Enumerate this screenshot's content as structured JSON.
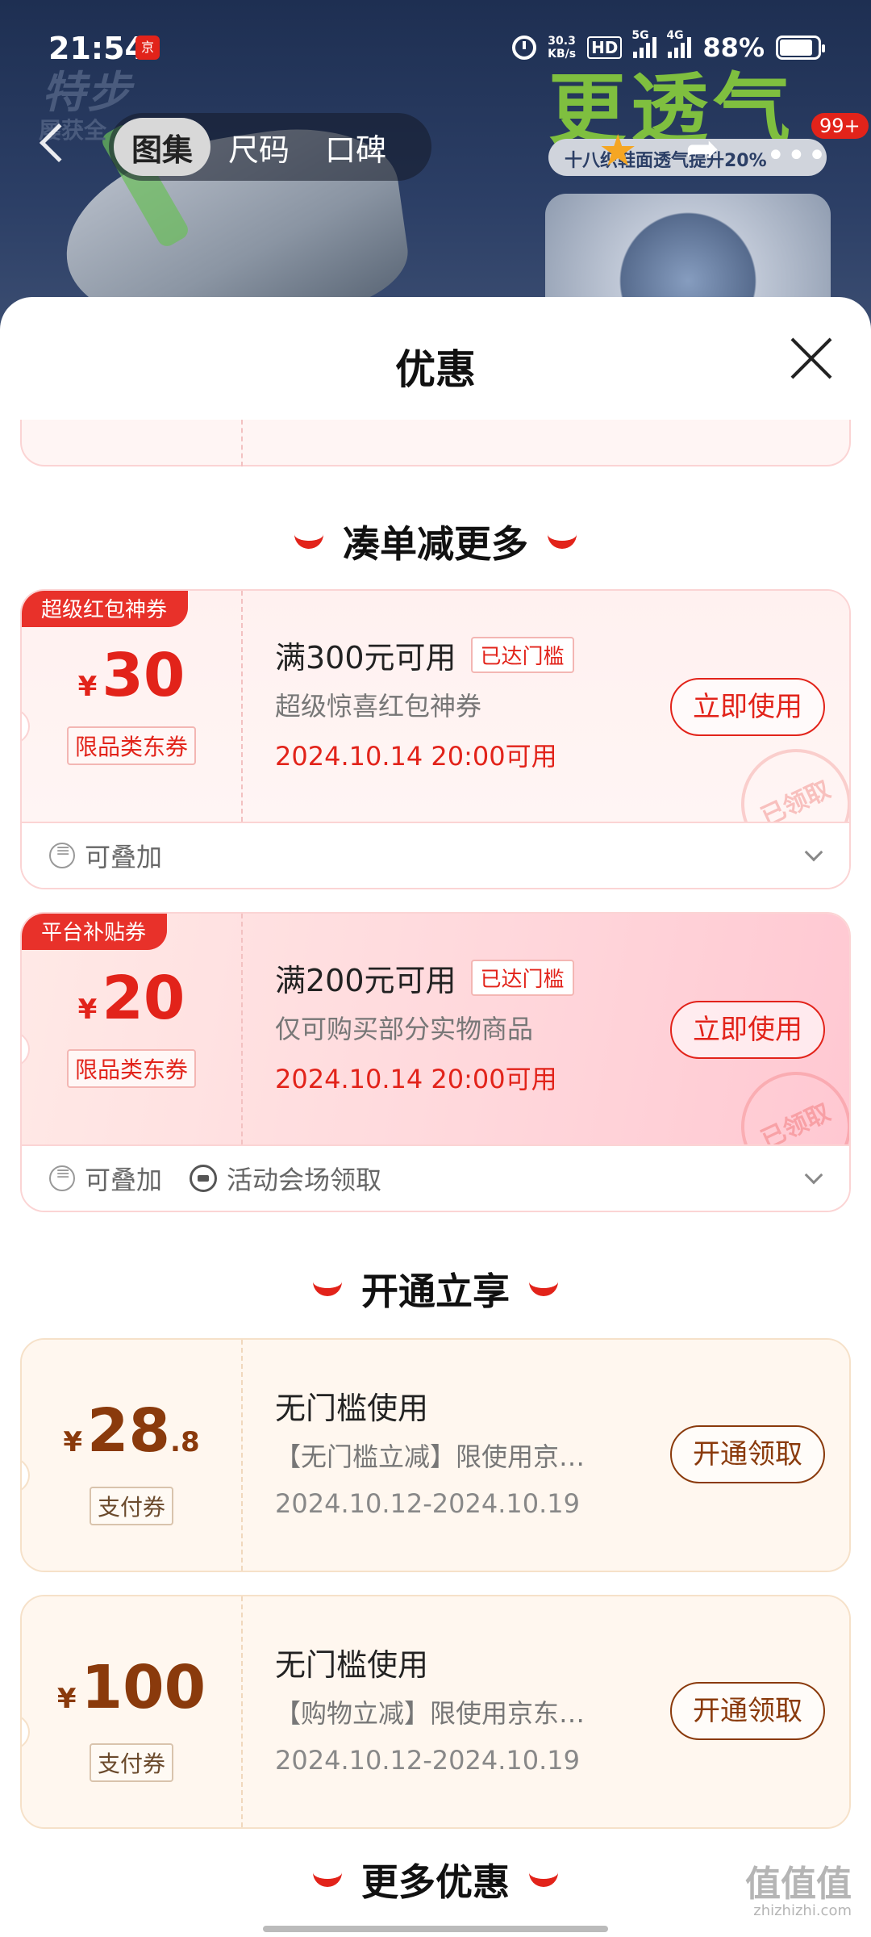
{
  "status_bar": {
    "time": "21:54",
    "net_speed_value": "30.3",
    "net_speed_unit": "KB/s",
    "hd": "HD",
    "net_5g": "5G",
    "net_4g": "4G",
    "battery": "88%"
  },
  "product_bg": {
    "brand": "特步",
    "brand_sub": "屡获全",
    "slogan": "更透气",
    "slogan_bar": "十八织鞋面透气提升20%",
    "badge": "99+"
  },
  "tabs": [
    {
      "label": "图集"
    },
    {
      "label": "尺码"
    },
    {
      "label": "口碑"
    }
  ],
  "sheet": {
    "title": "优惠"
  },
  "sections": {
    "combine": "凑单减更多",
    "open": "开通立享",
    "more": "更多优惠"
  },
  "coupons": [
    {
      "ribbon": "超级红包神券",
      "symbol": "¥",
      "amount": "30",
      "tag": "限品类东券",
      "condition": "满300元可用",
      "reached": "已达门槛",
      "desc": "超级惊喜红包神券",
      "date": "2024.10.14 20:00可用",
      "button": "立即使用",
      "stamp": "已领取",
      "foot_stack": "可叠加"
    },
    {
      "ribbon": "平台补贴券",
      "symbol": "¥",
      "amount": "20",
      "tag": "限品类东券",
      "condition": "满200元可用",
      "reached": "已达门槛",
      "desc": "仅可购买部分实物商品",
      "date": "2024.10.14 20:00可用",
      "button": "立即使用",
      "stamp": "已领取",
      "foot_stack": "可叠加",
      "foot_venue": "活动会场领取"
    },
    {
      "symbol": "¥",
      "amount": "28",
      "decimal": ".8",
      "tag": "支付券",
      "condition": "无门槛使用",
      "desc": "【无门槛立减】限使用京…",
      "date": "2024.10.12-2024.10.19",
      "button": "开通领取"
    },
    {
      "symbol": "¥",
      "amount": "100",
      "tag": "支付券",
      "condition": "无门槛使用",
      "desc": "【购物立减】限使用京东…",
      "date": "2024.10.12-2024.10.19",
      "button": "开通领取"
    }
  ],
  "watermark": {
    "main": "值值值",
    "site": "zhizhizhi.com"
  },
  "colors": {
    "accent": "#e2231a",
    "open_brown": "#8a3a0c"
  }
}
